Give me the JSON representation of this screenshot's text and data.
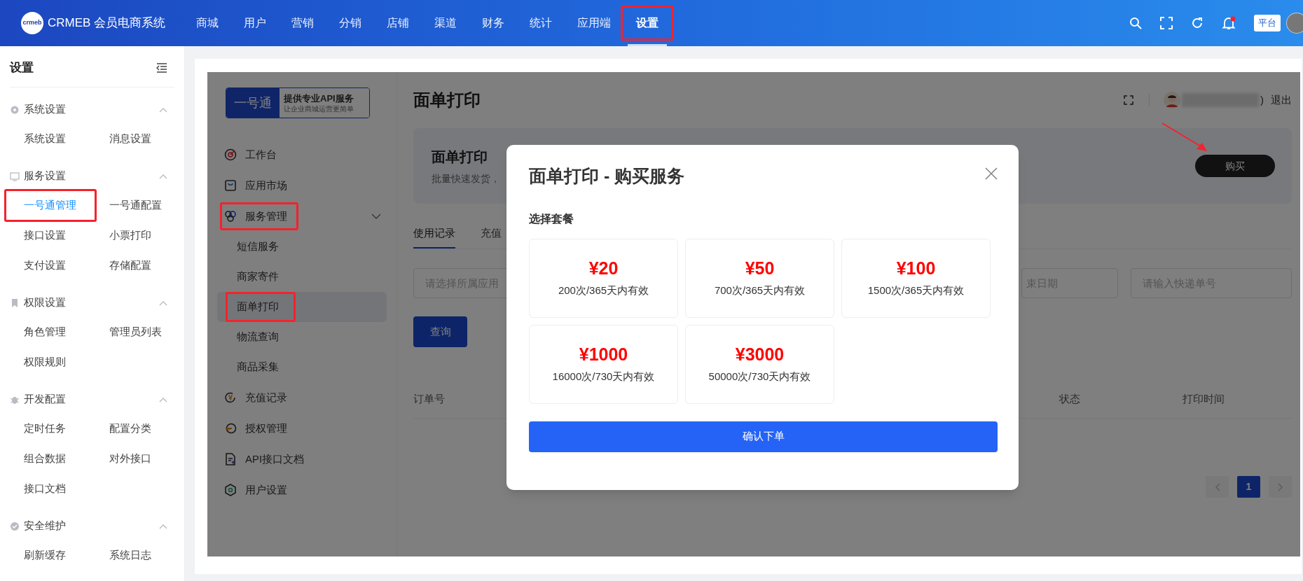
{
  "top_nav": {
    "logo_mark": "crmeb",
    "logo_text": "CRMEB 会员电商系统",
    "items": [
      {
        "label": "商城",
        "selected": false,
        "highlighted": false
      },
      {
        "label": "用户",
        "selected": false,
        "highlighted": false
      },
      {
        "label": "营销",
        "selected": false,
        "highlighted": false
      },
      {
        "label": "分销",
        "selected": false,
        "highlighted": false
      },
      {
        "label": "店铺",
        "selected": false,
        "highlighted": false
      },
      {
        "label": "渠道",
        "selected": false,
        "highlighted": false
      },
      {
        "label": "财务",
        "selected": false,
        "highlighted": false
      },
      {
        "label": "统计",
        "selected": false,
        "highlighted": false
      },
      {
        "label": "应用端",
        "selected": false,
        "highlighted": false
      },
      {
        "label": "设置",
        "selected": true,
        "highlighted": true
      }
    ],
    "platform_badge": "平台"
  },
  "sidebar": {
    "title": "设置",
    "sections": [
      {
        "title": "系统设置",
        "expanded": true,
        "items": [
          {
            "label": "系统设置",
            "selected": false,
            "highlighted": false
          },
          {
            "label": "消息设置",
            "selected": false,
            "highlighted": false
          }
        ]
      },
      {
        "title": "服务设置",
        "expanded": true,
        "items": [
          {
            "label": "一号通管理",
            "selected": true,
            "highlighted": true
          },
          {
            "label": "一号通配置",
            "selected": false,
            "highlighted": false
          },
          {
            "label": "接口设置",
            "selected": false,
            "highlighted": false
          },
          {
            "label": "小票打印",
            "selected": false,
            "highlighted": false
          },
          {
            "label": "支付设置",
            "selected": false,
            "highlighted": false
          },
          {
            "label": "存储配置",
            "selected": false,
            "highlighted": false
          }
        ]
      },
      {
        "title": "权限设置",
        "expanded": true,
        "items": [
          {
            "label": "角色管理",
            "selected": false,
            "highlighted": false
          },
          {
            "label": "管理员列表",
            "selected": false,
            "highlighted": false
          },
          {
            "label": "权限规则",
            "selected": false,
            "highlighted": false
          }
        ]
      },
      {
        "title": "开发配置",
        "expanded": true,
        "items": [
          {
            "label": "定时任务",
            "selected": false,
            "highlighted": false
          },
          {
            "label": "配置分类",
            "selected": false,
            "highlighted": false
          },
          {
            "label": "组合数据",
            "selected": false,
            "highlighted": false
          },
          {
            "label": "对外接口",
            "selected": false,
            "highlighted": false
          },
          {
            "label": "接口文档",
            "selected": false,
            "highlighted": false
          }
        ]
      },
      {
        "title": "安全维护",
        "expanded": true,
        "items": [
          {
            "label": "刷新缓存",
            "selected": false,
            "highlighted": false
          },
          {
            "label": "系统日志",
            "selected": false,
            "highlighted": false
          }
        ]
      }
    ]
  },
  "service_page": {
    "brand": {
      "name": "一号通",
      "slogan": "提供专业API服务",
      "subtitle": "让企业商城运营更简单"
    },
    "menu": [
      {
        "label": "工作台",
        "selected": false,
        "highlighted": false
      },
      {
        "label": "应用市场",
        "selected": false,
        "highlighted": false
      },
      {
        "label": "服务管理",
        "selected": false,
        "highlighted": true,
        "expanded": true,
        "children": [
          {
            "label": "短信服务",
            "selected": false,
            "highlighted": false
          },
          {
            "label": "商家寄件",
            "selected": false,
            "highlighted": false
          },
          {
            "label": "面单打印",
            "selected": true,
            "highlighted": true
          },
          {
            "label": "物流查询",
            "selected": false,
            "highlighted": false
          },
          {
            "label": "商品采集",
            "selected": false,
            "highlighted": false
          }
        ]
      },
      {
        "label": "充值记录",
        "selected": false,
        "highlighted": false
      },
      {
        "label": "授权管理",
        "selected": false,
        "highlighted": false
      },
      {
        "label": "API接口文档",
        "selected": false,
        "highlighted": false
      },
      {
        "label": "用户设置",
        "selected": false,
        "highlighted": false
      }
    ],
    "title": "面单打印",
    "name_suffix": ")",
    "logout": "退出",
    "banner": {
      "title": "面单打印",
      "description": "批量快速发货，",
      "buy_button": "购买"
    },
    "tabs": [
      {
        "label": "使用记录",
        "selected": true
      },
      {
        "label": "充值",
        "selected": false
      }
    ],
    "filters": [
      {
        "placeholder": "请选择所属应用"
      },
      {
        "placeholder": "束日期"
      },
      {
        "placeholder": "请输入快递单号"
      }
    ],
    "search_button": "查询",
    "table": {
      "columns": [
        "订单号",
        "状态",
        "打印时间"
      ]
    },
    "pagination": {
      "pages": [
        {
          "label": "1",
          "selected": true
        }
      ]
    }
  },
  "modal": {
    "title": "面单打印 - 购买服务",
    "section_label": "选择套餐",
    "packages": [
      {
        "price": "¥20",
        "description": "200次/365天内有效",
        "selected": false
      },
      {
        "price": "¥50",
        "description": "700次/365天内有效",
        "selected": false
      },
      {
        "price": "¥100",
        "description": "1500次/365天内有效",
        "selected": false
      },
      {
        "price": "¥1000",
        "description": "16000次/730天内有效",
        "selected": false
      },
      {
        "price": "¥3000",
        "description": "50000次/730天内有效",
        "selected": false
      }
    ],
    "confirm_button": "确认下单"
  }
}
